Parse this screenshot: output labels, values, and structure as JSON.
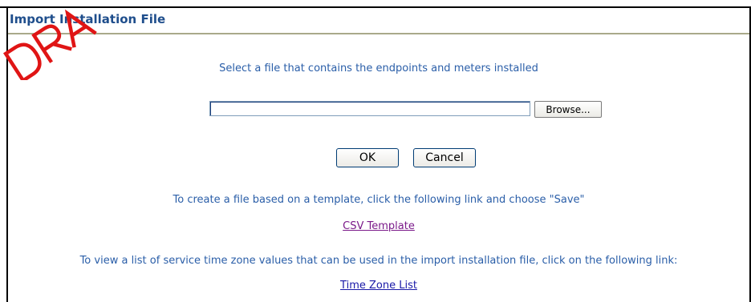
{
  "header": {
    "title": "Import Installation File"
  },
  "main": {
    "instruction": "Select a file that contains the endpoints and meters installed",
    "file_input_value": "",
    "browse_label": "Browse...",
    "ok_label": "OK",
    "cancel_label": "Cancel",
    "template_instruction": "To create a file based on a template, click the following link and choose \"Save\"",
    "csv_link": "CSV Template",
    "timezone_instruction": "To view a list of service time zone values that can be used in the import installation file, click on the following link:",
    "timezone_link": "Time Zone List"
  },
  "colors": {
    "title": "#1f4e8c",
    "text": "#2a5ea8",
    "visited_link": "#7b1a8a",
    "link": "#1a1aa8",
    "watermark": "#e01515"
  }
}
